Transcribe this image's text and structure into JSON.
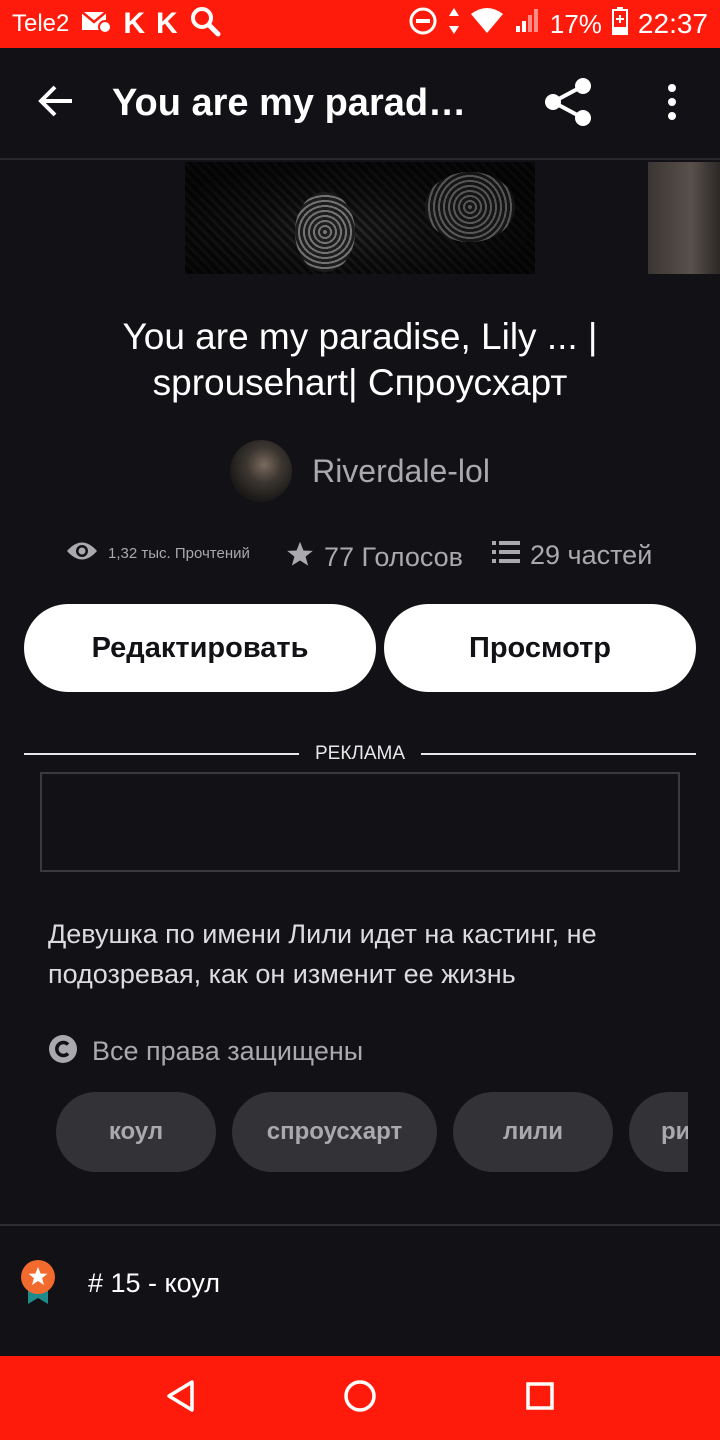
{
  "status_bar": {
    "carrier": "Tele2",
    "k1": "K",
    "k2": "K",
    "battery": "17%",
    "time": "22:37"
  },
  "app_bar": {
    "title": "You are my paradi…"
  },
  "story": {
    "title": "You are my paradise, Lily ... | sprousehart| Спроусхарт",
    "author": "Riverdale-lol",
    "reads": "1,32 тыс. Прочтений",
    "votes": "77 Голосов",
    "parts": "29 частей",
    "description": "Девушка по имени Лили идет на кастинг, не подозревая, как он изменит ее жизнь",
    "copyright": "Все права защищены",
    "ranking": "# 15 - коул"
  },
  "buttons": {
    "edit": "Редактировать",
    "view": "Просмотр"
  },
  "ad": {
    "label": "РЕКЛАМА"
  },
  "tags": [
    "коул",
    "спроусхарт",
    "лили",
    "ри"
  ],
  "colors": {
    "accent": "#ff1b0c",
    "background": "#121115",
    "muted_text": "#a9a9ae",
    "tag_bg": "#333236",
    "ranking_badge": "#f26a2e"
  },
  "icons": {
    "back": "arrow-left-icon",
    "share": "share-icon",
    "more": "more-vertical-icon",
    "reads": "eye-icon",
    "votes": "star-icon",
    "parts": "list-icon",
    "copyright": "copyright-icon",
    "ranking": "ranking-badge-icon"
  }
}
